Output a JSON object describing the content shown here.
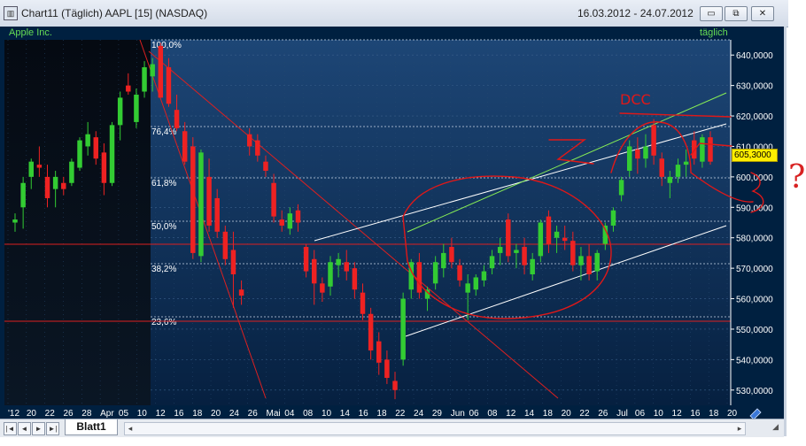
{
  "window": {
    "title": "Chart11 (Täglich)  AAPL [15] (NASDAQ)",
    "date_range": "16.03.2012 - 24.07.2012",
    "app_icon": "chart-icon",
    "buttons": {
      "minimize": "▭",
      "restore": "⧉",
      "close": "✕"
    }
  },
  "chart": {
    "instrument_label": "Apple Inc.",
    "period_label": "täglich",
    "current_price_tag": "605,3000",
    "colors": {
      "background": "#002040",
      "up": "#33cc33",
      "down": "#ee2222",
      "axis_text": "#ffffff",
      "legend": "#66dd55"
    },
    "fib_levels": [
      "100,0%",
      "76,4%",
      "61,8%",
      "50,0%",
      "38,2%",
      "23,6%"
    ],
    "annotations": {
      "top_label": "DCC",
      "note_question": "?"
    }
  },
  "chart_data": {
    "type": "candlestick",
    "y_ticks": [
      "640,0000",
      "630,0000",
      "620,0000",
      "610,0000",
      "600,0000",
      "590,0000",
      "580,0000",
      "570,0000",
      "560,0000",
      "550,0000",
      "540,0000",
      "530,0000"
    ],
    "ylim": [
      525,
      645
    ],
    "x_ticks": [
      "'12",
      "20",
      "22",
      "26",
      "28",
      "Apr",
      "05",
      "10",
      "12",
      "16",
      "18",
      "20",
      "24",
      "26",
      "Mai",
      "04",
      "08",
      "10",
      "14",
      "16",
      "18",
      "22",
      "24",
      "29",
      "Jun",
      "06",
      "08",
      "12",
      "14",
      "18",
      "20",
      "22",
      "26",
      "Jul",
      "06",
      "10",
      "12",
      "16",
      "18",
      "20"
    ],
    "candles": [
      {
        "o": 585,
        "h": 588,
        "l": 582,
        "c": 586
      },
      {
        "o": 590,
        "h": 600,
        "l": 583,
        "c": 598
      },
      {
        "o": 600,
        "h": 606,
        "l": 596,
        "c": 605
      },
      {
        "o": 604,
        "h": 610,
        "l": 600,
        "c": 603
      },
      {
        "o": 600,
        "h": 604,
        "l": 590,
        "c": 593
      },
      {
        "o": 596,
        "h": 602,
        "l": 590,
        "c": 600
      },
      {
        "o": 598,
        "h": 600,
        "l": 594,
        "c": 596
      },
      {
        "o": 598,
        "h": 606,
        "l": 597,
        "c": 605
      },
      {
        "o": 603,
        "h": 613,
        "l": 602,
        "c": 612
      },
      {
        "o": 610,
        "h": 618,
        "l": 607,
        "c": 614
      },
      {
        "o": 613,
        "h": 615,
        "l": 604,
        "c": 606
      },
      {
        "o": 608,
        "h": 611,
        "l": 594,
        "c": 598
      },
      {
        "o": 598,
        "h": 618,
        "l": 597,
        "c": 617
      },
      {
        "o": 617,
        "h": 628,
        "l": 612,
        "c": 626
      },
      {
        "o": 630,
        "h": 634,
        "l": 627,
        "c": 628
      },
      {
        "o": 618,
        "h": 629,
        "l": 616,
        "c": 627
      },
      {
        "o": 628,
        "h": 638,
        "l": 626,
        "c": 636
      },
      {
        "o": 633,
        "h": 639,
        "l": 628,
        "c": 637
      },
      {
        "o": 643,
        "h": 644,
        "l": 626,
        "c": 626
      },
      {
        "o": 636,
        "h": 639,
        "l": 623,
        "c": 624
      },
      {
        "o": 622,
        "h": 627,
        "l": 615,
        "c": 616
      },
      {
        "o": 615,
        "h": 618,
        "l": 604,
        "c": 605
      },
      {
        "o": 610,
        "h": 613,
        "l": 573,
        "c": 575
      },
      {
        "o": 574,
        "h": 609,
        "l": 572,
        "c": 608
      },
      {
        "o": 600,
        "h": 606,
        "l": 582,
        "c": 584
      },
      {
        "o": 593,
        "h": 596,
        "l": 580,
        "c": 582
      },
      {
        "o": 582,
        "h": 584,
        "l": 571,
        "c": 573
      },
      {
        "o": 576,
        "h": 582,
        "l": 557,
        "c": 568
      },
      {
        "o": 563,
        "h": 566,
        "l": 558,
        "c": 561
      },
      {
        "o": 614,
        "h": 616,
        "l": 607,
        "c": 610
      },
      {
        "o": 612,
        "h": 614,
        "l": 605,
        "c": 607
      },
      {
        "o": 605,
        "h": 607,
        "l": 600,
        "c": 602
      },
      {
        "o": 598,
        "h": 601,
        "l": 585,
        "c": 587
      },
      {
        "o": 586,
        "h": 589,
        "l": 582,
        "c": 584
      },
      {
        "o": 583,
        "h": 590,
        "l": 581,
        "c": 588
      },
      {
        "o": 589,
        "h": 591,
        "l": 582,
        "c": 585
      },
      {
        "o": 577,
        "h": 578,
        "l": 567,
        "c": 569
      },
      {
        "o": 573,
        "h": 576,
        "l": 558,
        "c": 565
      },
      {
        "o": 565,
        "h": 567,
        "l": 559,
        "c": 562
      },
      {
        "o": 564,
        "h": 574,
        "l": 561,
        "c": 572
      },
      {
        "o": 571,
        "h": 575,
        "l": 567,
        "c": 573
      },
      {
        "o": 572,
        "h": 576,
        "l": 566,
        "c": 569
      },
      {
        "o": 570,
        "h": 572,
        "l": 560,
        "c": 563
      },
      {
        "o": 562,
        "h": 565,
        "l": 553,
        "c": 555
      },
      {
        "o": 555,
        "h": 557,
        "l": 540,
        "c": 543
      },
      {
        "o": 546,
        "h": 549,
        "l": 535,
        "c": 539
      },
      {
        "o": 540,
        "h": 543,
        "l": 532,
        "c": 534
      },
      {
        "o": 533,
        "h": 536,
        "l": 527,
        "c": 530
      },
      {
        "o": 540,
        "h": 562,
        "l": 538,
        "c": 560
      },
      {
        "o": 563,
        "h": 573,
        "l": 560,
        "c": 572
      },
      {
        "o": 572,
        "h": 575,
        "l": 560,
        "c": 562
      },
      {
        "o": 560,
        "h": 564,
        "l": 556,
        "c": 563
      },
      {
        "o": 565,
        "h": 574,
        "l": 563,
        "c": 572
      },
      {
        "o": 570,
        "h": 578,
        "l": 567,
        "c": 575
      },
      {
        "o": 577,
        "h": 580,
        "l": 570,
        "c": 572
      },
      {
        "o": 571,
        "h": 573,
        "l": 564,
        "c": 566
      },
      {
        "o": 562,
        "h": 568,
        "l": 553,
        "c": 565
      },
      {
        "o": 563,
        "h": 568,
        "l": 561,
        "c": 567
      },
      {
        "o": 566,
        "h": 571,
        "l": 564,
        "c": 569
      },
      {
        "o": 570,
        "h": 576,
        "l": 568,
        "c": 574
      },
      {
        "o": 575,
        "h": 580,
        "l": 571,
        "c": 577
      },
      {
        "o": 586,
        "h": 588,
        "l": 572,
        "c": 574
      },
      {
        "o": 575,
        "h": 578,
        "l": 570,
        "c": 576
      },
      {
        "o": 577,
        "h": 580,
        "l": 568,
        "c": 571
      },
      {
        "o": 568,
        "h": 575,
        "l": 566,
        "c": 573
      },
      {
        "o": 574,
        "h": 586,
        "l": 572,
        "c": 585
      },
      {
        "o": 587,
        "h": 589,
        "l": 575,
        "c": 578
      },
      {
        "o": 580,
        "h": 584,
        "l": 575,
        "c": 582
      },
      {
        "o": 580,
        "h": 584,
        "l": 576,
        "c": 579
      },
      {
        "o": 579,
        "h": 582,
        "l": 569,
        "c": 571
      },
      {
        "o": 571,
        "h": 577,
        "l": 566,
        "c": 574
      },
      {
        "o": 574,
        "h": 578,
        "l": 566,
        "c": 568
      },
      {
        "o": 569,
        "h": 576,
        "l": 566,
        "c": 575
      },
      {
        "o": 578,
        "h": 585,
        "l": 576,
        "c": 584
      },
      {
        "o": 584,
        "h": 590,
        "l": 582,
        "c": 589
      },
      {
        "o": 594,
        "h": 600,
        "l": 592,
        "c": 599
      },
      {
        "o": 602,
        "h": 612,
        "l": 600,
        "c": 610
      },
      {
        "o": 609,
        "h": 613,
        "l": 601,
        "c": 606
      },
      {
        "o": 606,
        "h": 614,
        "l": 603,
        "c": 610
      },
      {
        "o": 617,
        "h": 619,
        "l": 604,
        "c": 607
      },
      {
        "o": 606,
        "h": 608,
        "l": 597,
        "c": 600
      },
      {
        "o": 598,
        "h": 602,
        "l": 593,
        "c": 600
      },
      {
        "o": 600,
        "h": 606,
        "l": 598,
        "c": 604
      },
      {
        "o": 604,
        "h": 609,
        "l": 600,
        "c": 605
      },
      {
        "o": 612,
        "h": 615,
        "l": 604,
        "c": 606
      },
      {
        "o": 605,
        "h": 614,
        "l": 603,
        "c": 613
      },
      {
        "o": 613,
        "h": 615,
        "l": 604,
        "c": 605
      }
    ]
  },
  "statusbar": {
    "sheet_tab": "Blatt1",
    "nav_buttons": [
      "|◄",
      "◄",
      "►",
      "►|"
    ],
    "scroll_left": "◂",
    "scroll_right": "▸"
  }
}
